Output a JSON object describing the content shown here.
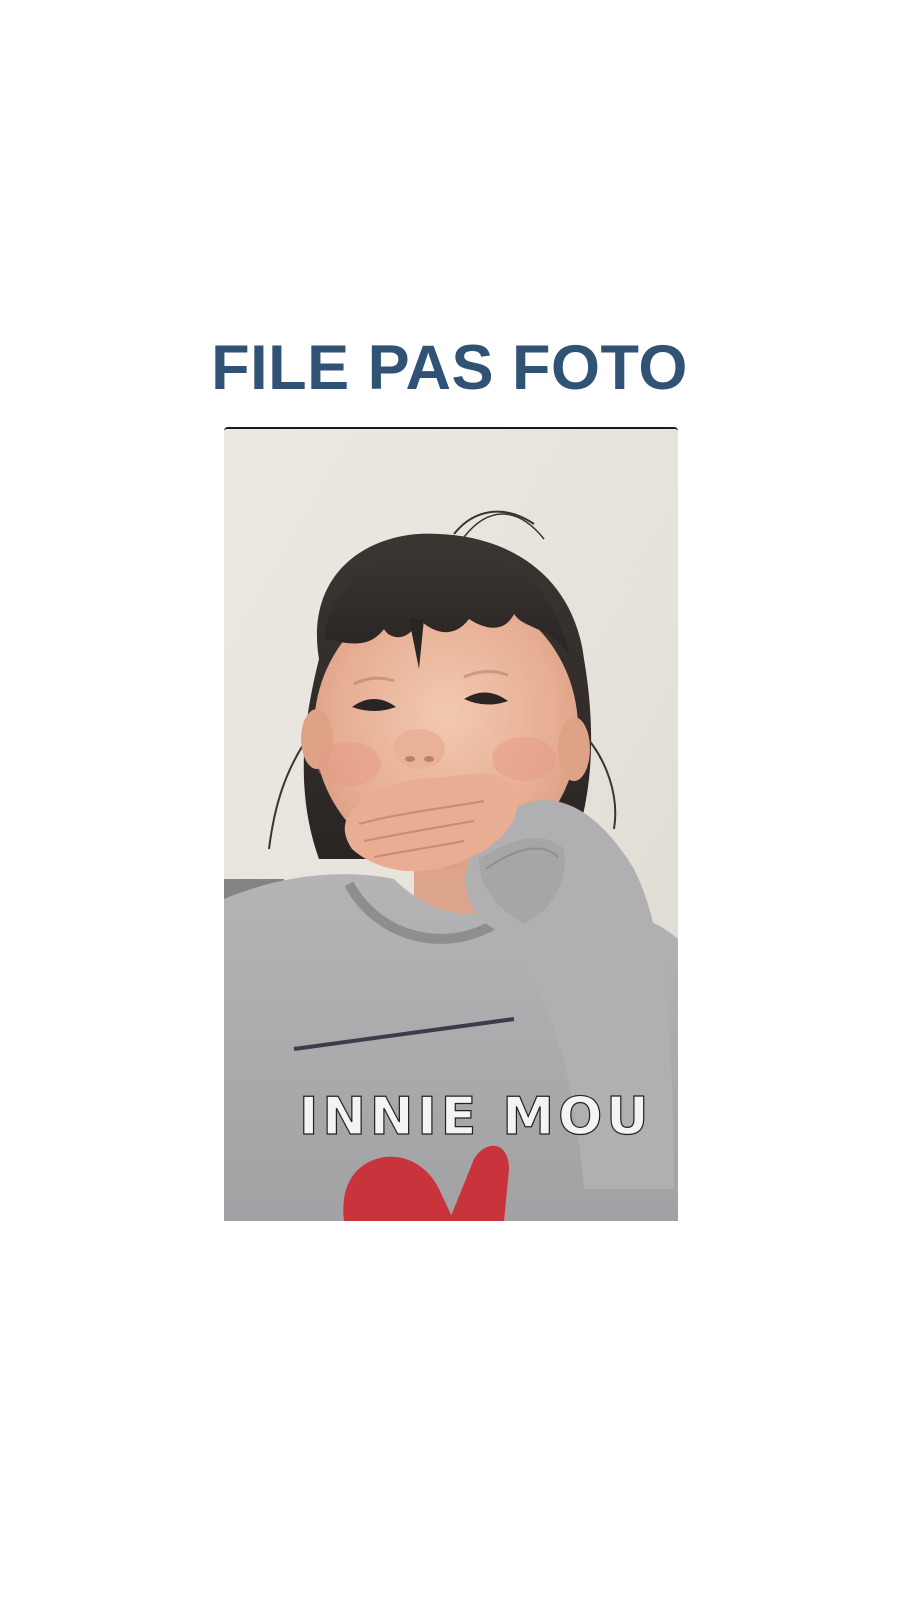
{
  "header": {
    "title": "FILE PAS FOTO"
  },
  "photo": {
    "subject": "child-laughing-photo",
    "shirt_print": "INNIE MOU"
  },
  "colors": {
    "title": "#2f5275",
    "background": "#ffffff",
    "wall": "#e9e6df",
    "shirt": "#a9a9ab",
    "shirt_bow": "#c9333b"
  }
}
